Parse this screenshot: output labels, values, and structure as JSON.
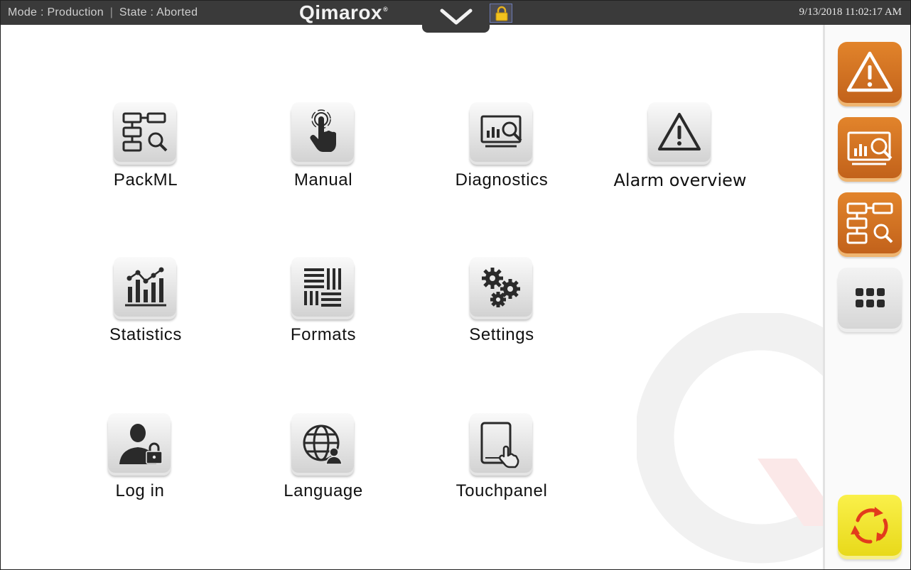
{
  "header": {
    "mode_text": "Mode : Production",
    "separator": "|",
    "state_text": "State : Aborted",
    "logo": "Qimarox",
    "logo_reg": "®",
    "datetime": "9/13/2018 11:02:17 AM"
  },
  "menu": {
    "items": [
      {
        "label": "PackML",
        "icon": "packml-icon"
      },
      {
        "label": "Manual",
        "icon": "hand-pointer-icon"
      },
      {
        "label": "Diagnostics",
        "icon": "diagnostics-monitor-icon"
      },
      {
        "label": "Alarm overview",
        "icon": "warning-triangle-icon"
      },
      {
        "label": "Statistics",
        "icon": "bar-chart-icon"
      },
      {
        "label": "Formats",
        "icon": "formats-grid-icon"
      },
      {
        "label": "Settings",
        "icon": "gears-icon"
      },
      {
        "label": "Log in",
        "icon": "user-lock-icon"
      },
      {
        "label": "Language",
        "icon": "globe-user-icon"
      },
      {
        "label": "Touchpanel",
        "icon": "tablet-touch-icon"
      }
    ]
  },
  "side": {
    "buttons": [
      {
        "icon": "warning-triangle-icon",
        "color": "#d97524"
      },
      {
        "icon": "diagnostics-monitor-icon",
        "color": "#d97524"
      },
      {
        "icon": "packml-icon",
        "color": "#d97524"
      },
      {
        "icon": "grid-dots-icon",
        "color": "#e0e0e0"
      },
      {
        "icon": "refresh-arrows-icon",
        "color": "#f4e62c"
      }
    ]
  },
  "colors": {
    "topbar": "#3a3a3a",
    "accent": "#d97524",
    "reset": "#f4e62c",
    "reset_arrows": "#e23b1c"
  }
}
